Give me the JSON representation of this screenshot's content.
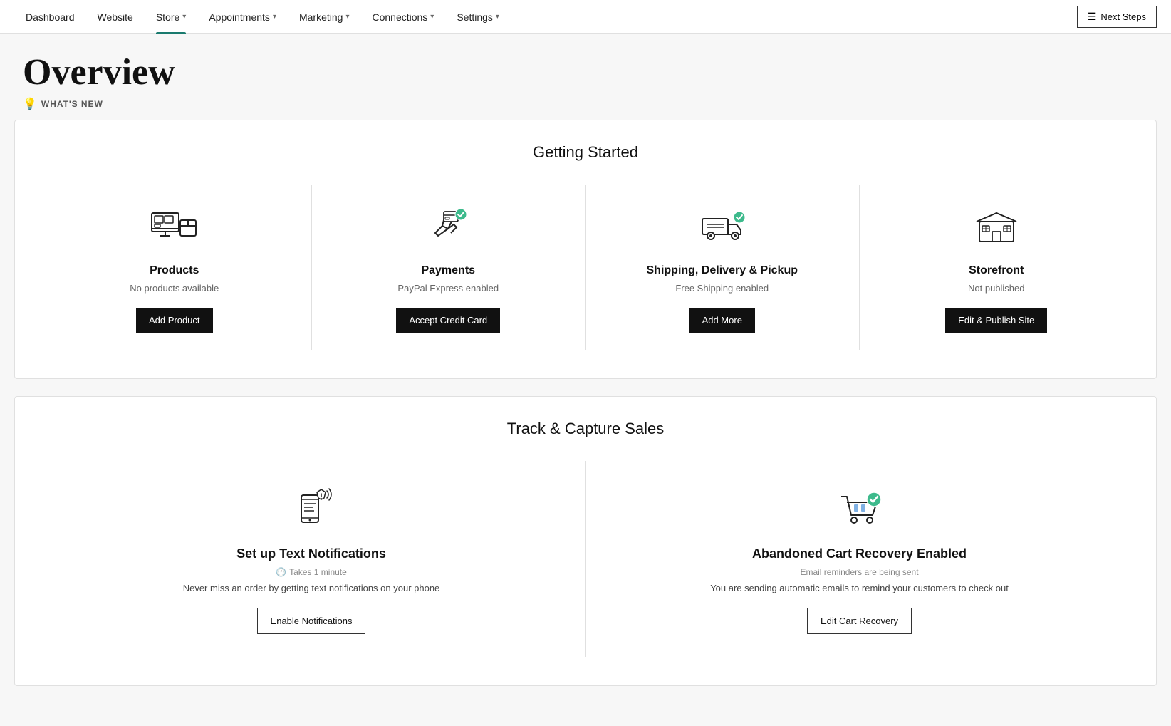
{
  "nav": {
    "items": [
      {
        "label": "Dashboard",
        "active": false,
        "hasDropdown": false
      },
      {
        "label": "Website",
        "active": false,
        "hasDropdown": false
      },
      {
        "label": "Store",
        "active": true,
        "hasDropdown": true
      },
      {
        "label": "Appointments",
        "active": false,
        "hasDropdown": true
      },
      {
        "label": "Marketing",
        "active": false,
        "hasDropdown": true
      },
      {
        "label": "Connections",
        "active": false,
        "hasDropdown": true
      },
      {
        "label": "Settings",
        "active": false,
        "hasDropdown": true
      }
    ],
    "next_steps_label": "Next Steps",
    "next_steps_icon": "≡"
  },
  "header": {
    "title": "Overview",
    "whats_new_label": "WHAT'S NEW"
  },
  "getting_started": {
    "section_title": "Getting Started",
    "items": [
      {
        "id": "products",
        "title": "Products",
        "subtitle": "No products available",
        "button_label": "Add Product"
      },
      {
        "id": "payments",
        "title": "Payments",
        "subtitle": "PayPal Express enabled",
        "button_label": "Accept Credit Card"
      },
      {
        "id": "shipping",
        "title": "Shipping, Delivery & Pickup",
        "subtitle": "Free Shipping enabled",
        "button_label": "Add More"
      },
      {
        "id": "storefront",
        "title": "Storefront",
        "subtitle": "Not published",
        "button_label": "Edit & Publish Site"
      }
    ]
  },
  "track_capture": {
    "section_title": "Track & Capture Sales",
    "items": [
      {
        "id": "notifications",
        "title": "Set up Text Notifications",
        "time_label": "Takes 1 minute",
        "description": "Never miss an order by getting text notifications on your phone",
        "button_label": "Enable Notifications",
        "button_type": "outline"
      },
      {
        "id": "cart_recovery",
        "title": "Abandoned Cart Recovery Enabled",
        "subtitle": "Email reminders are being sent",
        "description": "You are sending automatic emails to remind your customers to check out",
        "button_label": "Edit Cart Recovery",
        "button_type": "outline"
      }
    ]
  }
}
